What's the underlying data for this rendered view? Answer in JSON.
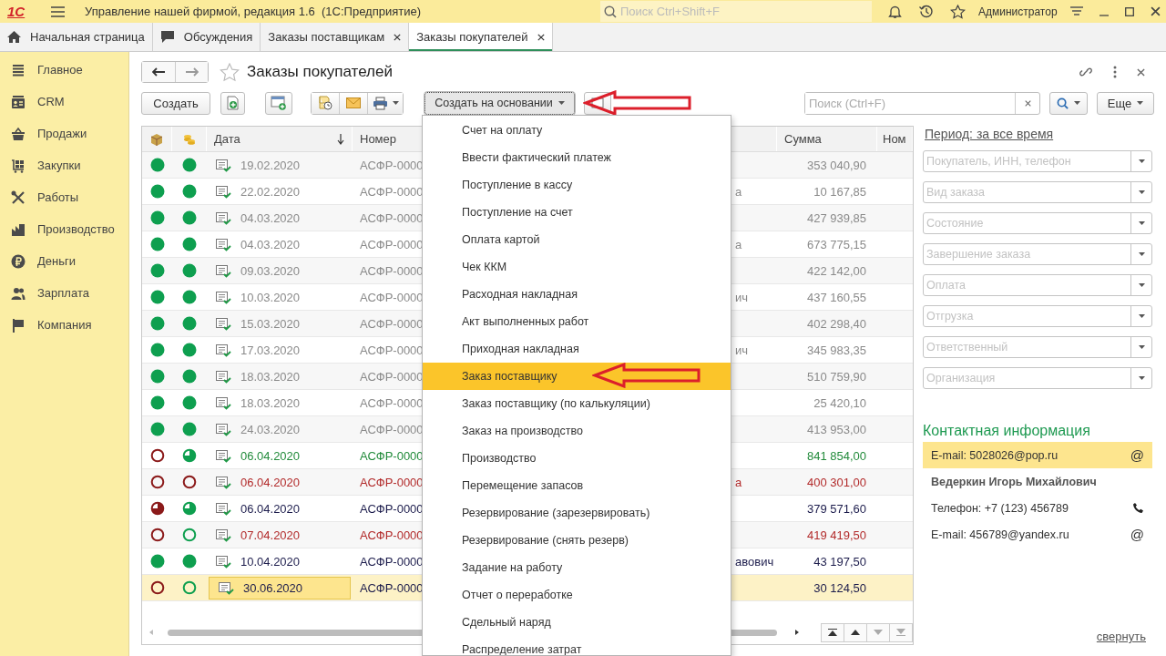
{
  "window": {
    "logo": "1С",
    "title": "Управление нашей фирмой, редакция 1.6  (1С:Предприятие)",
    "search_placeholder": "Поиск Ctrl+Shift+F",
    "user": "Администратор"
  },
  "tabs": [
    {
      "kind": "home",
      "label": "Начальная страница",
      "closable": false,
      "selected": false
    },
    {
      "kind": "chat",
      "label": "Обсуждения",
      "closable": false,
      "selected": false
    },
    {
      "kind": "plain",
      "label": "Заказы поставщикам",
      "closable": true,
      "selected": false
    },
    {
      "kind": "plain",
      "label": "Заказы покупателей",
      "closable": true,
      "selected": true
    }
  ],
  "sidebar": {
    "items": [
      {
        "kind": "menu",
        "label": "Главное"
      },
      {
        "kind": "crm",
        "label": "CRM"
      },
      {
        "kind": "sales",
        "label": "Продажи"
      },
      {
        "kind": "purchases",
        "label": "Закупки"
      },
      {
        "kind": "works",
        "label": "Работы"
      },
      {
        "kind": "production",
        "label": "Производство"
      },
      {
        "kind": "money",
        "label": "Деньги"
      },
      {
        "kind": "salary",
        "label": "Зарплата"
      },
      {
        "kind": "company",
        "label": "Компания"
      }
    ]
  },
  "form": {
    "title": "Заказы покупателей"
  },
  "toolbar": {
    "create_button": "Создать",
    "create_based_on_button": "Создать на основании",
    "search_placeholder": "Поиск (Ctrl+F)",
    "more_button": "Еще"
  },
  "table": {
    "columns": [
      "Дата",
      "Номер",
      "Сумма",
      "Ном"
    ],
    "rows": [
      {
        "color": "#8a8a8a",
        "selected": false,
        "shipment": {
          "kind": "full",
          "color": "#0e9f4f"
        },
        "payment": {
          "kind": "full",
          "color": "#0e9f4f"
        },
        "date": "19.02.2020",
        "number": "АСФР-0000",
        "sum": "353 040,90"
      },
      {
        "color": "#8a8a8a",
        "selected": false,
        "shipment": {
          "kind": "full",
          "color": "#0e9f4f"
        },
        "payment": {
          "kind": "full",
          "color": "#0e9f4f"
        },
        "date": "22.02.2020",
        "number": "АСФР-0000",
        "column_5": "а",
        "sum": "10 167,85"
      },
      {
        "color": "#8a8a8a",
        "selected": false,
        "shipment": {
          "kind": "full",
          "color": "#0e9f4f"
        },
        "payment": {
          "kind": "full",
          "color": "#0e9f4f"
        },
        "date": "04.03.2020",
        "number": "АСФР-0000",
        "sum": "427 939,85"
      },
      {
        "color": "#8a8a8a",
        "selected": false,
        "shipment": {
          "kind": "full",
          "color": "#0e9f4f"
        },
        "payment": {
          "kind": "full",
          "color": "#0e9f4f"
        },
        "date": "04.03.2020",
        "number": "АСФР-0000",
        "column_5": "а",
        "sum": "673 775,15"
      },
      {
        "color": "#8a8a8a",
        "selected": false,
        "shipment": {
          "kind": "full",
          "color": "#0e9f4f"
        },
        "payment": {
          "kind": "full",
          "color": "#0e9f4f"
        },
        "date": "09.03.2020",
        "number": "АСФР-0000",
        "sum": "422 142,00"
      },
      {
        "color": "#8a8a8a",
        "selected": false,
        "shipment": {
          "kind": "full",
          "color": "#0e9f4f"
        },
        "payment": {
          "kind": "full",
          "color": "#0e9f4f"
        },
        "date": "10.03.2020",
        "number": "АСФР-0000",
        "column_5": "ич",
        "sum": "437 160,55"
      },
      {
        "color": "#8a8a8a",
        "selected": false,
        "shipment": {
          "kind": "full",
          "color": "#0e9f4f"
        },
        "payment": {
          "kind": "full",
          "color": "#0e9f4f"
        },
        "date": "15.03.2020",
        "number": "АСФР-0000",
        "sum": "402 298,40"
      },
      {
        "color": "#8a8a8a",
        "selected": false,
        "shipment": {
          "kind": "full",
          "color": "#0e9f4f"
        },
        "payment": {
          "kind": "full",
          "color": "#0e9f4f"
        },
        "date": "17.03.2020",
        "number": "АСФР-0000",
        "column_5": "ич",
        "sum": "345 983,35"
      },
      {
        "color": "#8a8a8a",
        "selected": false,
        "shipment": {
          "kind": "full",
          "color": "#0e9f4f"
        },
        "payment": {
          "kind": "full",
          "color": "#0e9f4f"
        },
        "date": "18.03.2020",
        "number": "АСФР-0000",
        "sum": "510 759,90"
      },
      {
        "color": "#8a8a8a",
        "selected": false,
        "shipment": {
          "kind": "full",
          "color": "#0e9f4f"
        },
        "payment": {
          "kind": "full",
          "color": "#0e9f4f"
        },
        "date": "18.03.2020",
        "number": "АСФР-0000",
        "sum": "25 420,10"
      },
      {
        "color": "#8a8a8a",
        "selected": false,
        "shipment": {
          "kind": "full",
          "color": "#0e9f4f"
        },
        "payment": {
          "kind": "full",
          "color": "#0e9f4f"
        },
        "date": "24.03.2020",
        "number": "АСФР-0000",
        "sum": "413 953,00"
      },
      {
        "color": "#228b3b",
        "selected": false,
        "shipment": {
          "kind": "empty",
          "color": "#8b1a1a"
        },
        "payment": {
          "kind": "partial",
          "color": "#0e9f4f"
        },
        "date": "06.04.2020",
        "number": "АСФР-0000",
        "sum": "841 854,00"
      },
      {
        "color": "#b22a2a",
        "selected": false,
        "shipment": {
          "kind": "empty",
          "color": "#8b1a1a"
        },
        "payment": {
          "kind": "empty",
          "color": "#8b1a1a"
        },
        "date": "06.04.2020",
        "number": "АСФР-0000",
        "column_5": "а",
        "sum": "400 301,00"
      },
      {
        "color": "#1c1c4c",
        "selected": false,
        "shipment": {
          "kind": "partial",
          "color": "#8b1a1a"
        },
        "payment": {
          "kind": "partial",
          "color": "#0e9f4f"
        },
        "date": "06.04.2020",
        "number": "АСФР-0000",
        "sum": "379 571,60"
      },
      {
        "color": "#b22a2a",
        "selected": false,
        "shipment": {
          "kind": "empty",
          "color": "#8b1a1a"
        },
        "payment": {
          "kind": "empty",
          "color": "#0e9f4f"
        },
        "date": "07.04.2020",
        "number": "АСФР-0000",
        "sum": "419 419,50"
      },
      {
        "color": "#1c1c4c",
        "selected": false,
        "shipment": {
          "kind": "full",
          "color": "#0e9f4f"
        },
        "payment": {
          "kind": "full",
          "color": "#0e9f4f"
        },
        "date": "10.04.2020",
        "number": "АСФР-0000",
        "column_5": "авович",
        "sum": "43 197,50"
      },
      {
        "color": "#1c1c4c",
        "selected": true,
        "shipment": {
          "kind": "empty",
          "color": "#8b1a1a"
        },
        "payment": {
          "kind": "empty",
          "color": "#0e9f4f"
        },
        "date": "30.06.2020",
        "number": "АСФР-0000",
        "sum": "30 124,50"
      }
    ]
  },
  "menu": {
    "items": [
      {
        "label": "Счет на оплату",
        "selected": false
      },
      {
        "label": "Ввести фактический платеж",
        "selected": false
      },
      {
        "label": "Поступление в кассу",
        "selected": false
      },
      {
        "label": "Поступление на счет",
        "selected": false
      },
      {
        "label": "Оплата картой",
        "selected": false
      },
      {
        "label": "Чек ККМ",
        "selected": false
      },
      {
        "label": "Расходная накладная",
        "selected": false
      },
      {
        "label": "Акт выполненных работ",
        "selected": false
      },
      {
        "label": "Приходная накладная",
        "selected": false
      },
      {
        "label": "Заказ поставщику",
        "selected": true
      },
      {
        "label": "Заказ поставщику (по калькуляции)",
        "selected": false
      },
      {
        "label": "Заказ на производство",
        "selected": false
      },
      {
        "label": "Производство",
        "selected": false
      },
      {
        "label": "Перемещение запасов",
        "selected": false
      },
      {
        "label": "Резервирование (зарезервировать)",
        "selected": false
      },
      {
        "label": "Резервирование (снять резерв)",
        "selected": false
      },
      {
        "label": "Задание на работу",
        "selected": false
      },
      {
        "label": "Отчет о переработке",
        "selected": false
      },
      {
        "label": "Сдельный наряд",
        "selected": false
      },
      {
        "label": "Распределение затрат",
        "selected": false
      }
    ]
  },
  "filters": {
    "period_link": "Период: за все время",
    "fields": [
      {
        "placeholder": "Покупатель, ИНН, телефон"
      },
      {
        "placeholder": "Вид заказа"
      },
      {
        "placeholder": "Состояние"
      },
      {
        "placeholder": "Завершение заказа"
      },
      {
        "placeholder": "Оплата"
      },
      {
        "placeholder": "Отгрузка"
      },
      {
        "placeholder": "Ответственный"
      },
      {
        "placeholder": "Организация"
      }
    ]
  },
  "contacts": {
    "title": "Контактная информация",
    "items": [
      {
        "kind": "email",
        "text": "E-mail: 5028026@pop.ru",
        "icon_char": "@",
        "selected": true
      },
      {
        "kind": "name",
        "text": "Ведеркин Игорь Михайлович",
        "selected": false
      },
      {
        "kind": "phone",
        "text": "Телефон: +7 (123) 456789",
        "selected": false
      },
      {
        "kind": "email",
        "text": "E-mail: 456789@yandex.ru",
        "icon_char": "@",
        "selected": false
      }
    ]
  },
  "collapse_link": "свернуть"
}
